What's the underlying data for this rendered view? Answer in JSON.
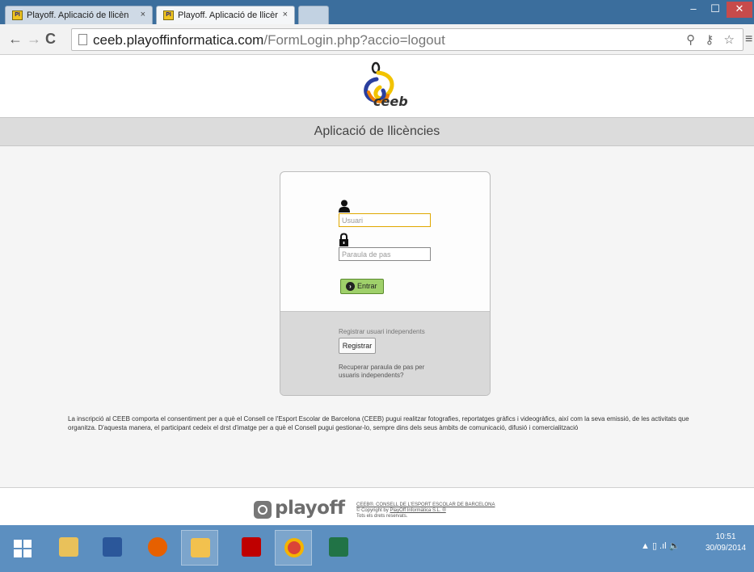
{
  "browser": {
    "tabs": [
      {
        "favicon": "PI",
        "label": "Playoff. Aplicació de llicèn",
        "close": "×"
      },
      {
        "favicon": "PI",
        "label": "Playoff. Aplicació de llicèr",
        "close": "×"
      }
    ],
    "window_controls": {
      "minimize": "–",
      "maximize": "☐",
      "close": "✕"
    },
    "url_host": "ceeb.playoffinformatica.com",
    "url_path": "/FormLogin.php?accio=logout",
    "nav": {
      "back": "←",
      "forward": "→",
      "reload": "C"
    },
    "omnibox_icons": "⚲ ⚷ ☆",
    "menu": "≡"
  },
  "page": {
    "logo_text": "ceeb",
    "title": "Aplicació de llicències",
    "login": {
      "user_placeholder": "Usuari",
      "password_placeholder": "Paraula de pas",
      "submit_label": "Entrar",
      "register_text": "Registrar usuari independents",
      "register_button": "Registrar",
      "recover_text": "Recuperar paraula de pas per usuaris independents?"
    },
    "notice": "La inscripció al CEEB comporta el consentiment per a què el Consell ce l'Esport Escolar de Barcelona (CEEB) pugui realitzar fotografies, reportatges gràfics i videogràfics, així com la seva emissió, de les activitats que organitza. D'aquesta manera, el participant cedeix el drst d'imatge per a què el Consell pugui gestionar-lo, sempre dins dels seus àmbits de comunicació, difusió i comercialització"
  },
  "footer": {
    "brand": "playoff",
    "org": "CEEB®. CONSELL DE L'ESPORT ESCOLAR DE BARCELONA",
    "copyright_prefix": "© Copyright by ",
    "copyright_link": "PlayOff Informàtica S.L. ®",
    "rights": "Tots els drets reservats."
  },
  "taskbar": {
    "apps": [
      "start",
      "file-explorer",
      "word",
      "firefox",
      "outlook",
      "filezilla",
      "chrome",
      "excel"
    ],
    "tray_icons": "▲  ▯  .ıl  🔈",
    "time": "10:51",
    "date": "30/09/2014"
  },
  "colors": {
    "tabstrip": "#3b6e9d",
    "taskbar": "#5c8fc0",
    "entrar_button": "#9fd06a",
    "logo_yellow": "#f2c300",
    "logo_blue": "#2a3f9e",
    "logo_orange": "#ef7d00"
  }
}
